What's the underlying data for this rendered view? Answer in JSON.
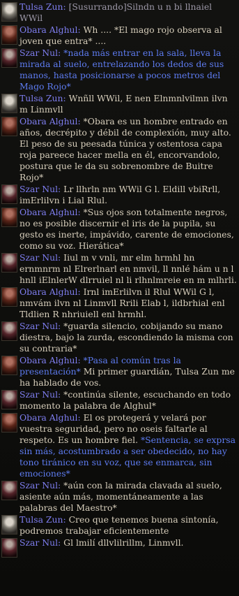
{
  "chat": {
    "entries": [
      {
        "speaker": "Tulsa Zun:",
        "avatar": "tulsa-portrait",
        "parts": [
          {
            "t": "whisper",
            "v": " [Susurrando]Silndn u n bi llnaiel WWil"
          }
        ]
      },
      {
        "speaker": "Obara Alghul:",
        "avatar": "obara-portrait",
        "parts": [
          {
            "t": "text",
            "v": " Wh .... *El mago rojo observa al joven que entra* ...."
          }
        ]
      },
      {
        "speaker": "Szar Nul:",
        "avatar": "szar-portrait",
        "parts": [
          {
            "t": "emote",
            "v": " *nada más entrar en la sala, lleva la mirada al suelo, entrelazando los dedos de sus manos, hasta posicionarse a pocos metros del Mago Rojo*"
          }
        ]
      },
      {
        "speaker": "Tulsa Zun:",
        "avatar": "tulsa-portrait",
        "parts": [
          {
            "t": "text",
            "v": " Wnñll WWil, E nen Elnmnlvilmn ilvn m  Linmvll"
          }
        ]
      },
      {
        "speaker": "Obara Alghul:",
        "avatar": "obara-portrait",
        "parts": [
          {
            "t": "text",
            "v": " *Obara es un hombre entrado en años, decrépito y débil de complexión, muy alto. El peso de su peesada túnica y ostentosa capa roja pareece hacer mella en él, encorvandolo, postura que le da su sobrenombre de Buitre Rojo*"
          }
        ]
      },
      {
        "speaker": "Szar Nul:",
        "avatar": "szar-portrait",
        "parts": [
          {
            "t": "text",
            "v": " Lr llhrln nm WWil G l. Eldill vbiRrll, imErlilvn i Lial Rlul."
          }
        ]
      },
      {
        "speaker": "Obara Alghul:",
        "avatar": "obara-portrait",
        "parts": [
          {
            "t": "text",
            "v": " *Sus ojos son totalmente negros, no es posible discernir el iris de la pupila, su gesto es inerte, impávido, carente de emociones, como su voz. Hierática*"
          }
        ]
      },
      {
        "speaker": "Szar Nul:",
        "avatar": "szar-portrait",
        "parts": [
          {
            "t": "text",
            "v": " Iiul m  v vnli, mr elm hrmhl hn ernmnrm nl Elrerlnarl en nmvil, ll nnlé hám u n  l hnll iElnlerW dlrruiel nl li rlhnlmreie en m  mlhrli."
          }
        ]
      },
      {
        "speaker": "Obara Alghul:",
        "avatar": "obara-portrait",
        "parts": [
          {
            "t": "text",
            "v": " Irnl imErlilvn il Rlul WWil G l, nmvám ilvn nl Linmvll Rrili Elab l, ildbrhial enl Tldlien R nhriuiell enl hrmhl."
          }
        ]
      },
      {
        "speaker": "Szar Nul:",
        "avatar": "szar-portrait",
        "parts": [
          {
            "t": "text",
            "v": " *guarda silencio, cobijando su mano diestra, bajo la zurda, escondiendo la misma con su contraria*"
          }
        ]
      },
      {
        "speaker": "Obara Alghul:",
        "avatar": "obara-portrait",
        "parts": [
          {
            "t": "emote",
            "v": " *Pasa al común tras la presentación*"
          },
          {
            "t": "text",
            "v": " Mi primer guardián, Tulsa Zun me ha hablado de vos."
          }
        ]
      },
      {
        "speaker": "Szar Nul:",
        "avatar": "szar-portrait",
        "parts": [
          {
            "t": "text",
            "v": " *continúa silente, escuchando en todo momento la palabra de Alghul*"
          }
        ]
      },
      {
        "speaker": "Obara Alghul:",
        "avatar": "obara-portrait",
        "parts": [
          {
            "t": "text",
            "v": " El os protegerá y velará por vuestra seguridad, pero no oseis faltarle al respeto. Es un hombre fiel. "
          },
          {
            "t": "emote",
            "v": "*Sentencia, se exprsa sin más, acostumbrado a ser obedecido, no hay tono tiránico en su voz, que se enmarca, sin emociones*"
          }
        ]
      },
      {
        "speaker": "Szar Nul:",
        "avatar": "szar-portrait",
        "parts": [
          {
            "t": "text",
            "v": " *aún con la mirada clavada al suelo, asiente aún más, momentáneamente a las palabras del Maestro*"
          }
        ]
      },
      {
        "speaker": "Tulsa Zun:",
        "avatar": "tulsa-portrait",
        "parts": [
          {
            "t": "text",
            "v": " Creo que tenemos buena sintonía, podremos trabajar eficientemente"
          }
        ]
      },
      {
        "speaker": "Szar Nul:",
        "avatar": "szar-portrait",
        "parts": [
          {
            "t": "text",
            "v": " Gl lmilí dllvlilrillm, Linmvll."
          }
        ]
      }
    ]
  }
}
